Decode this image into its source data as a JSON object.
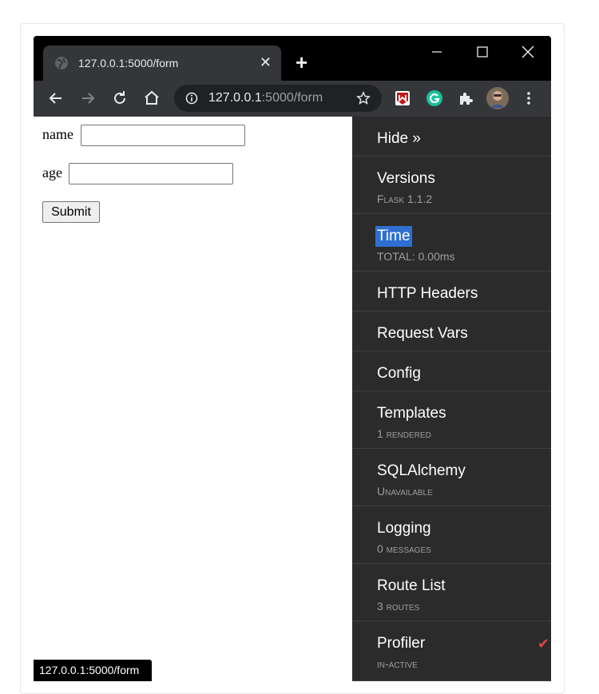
{
  "browser": {
    "tab_title": "127.0.0.1:5000/form",
    "url_host": "127.0.0.1",
    "url_rest": ":5000/form",
    "status_url": "127.0.0.1:5000/form",
    "tab_close": "✕",
    "new_tab": "+"
  },
  "form": {
    "name_label": "name",
    "name_value": "",
    "age_label": "age",
    "age_value": "",
    "submit_label": "Submit"
  },
  "debug_toolbar": {
    "hide_label": "Hide »",
    "items": [
      {
        "title": "Versions",
        "subtitle": "Flask 1.1.2"
      },
      {
        "title": "Time",
        "subtitle": "TOTAL: 0.00ms",
        "selected": true
      },
      {
        "title": "HTTP Headers",
        "subtitle": ""
      },
      {
        "title": "Request Vars",
        "subtitle": ""
      },
      {
        "title": "Config",
        "subtitle": ""
      },
      {
        "title": "Templates",
        "subtitle": "1 rendered"
      },
      {
        "title": "SQLAlchemy",
        "subtitle": "Unavailable"
      },
      {
        "title": "Logging",
        "subtitle": "0 messages"
      },
      {
        "title": "Route List",
        "subtitle": "3 routes"
      },
      {
        "title": "Profiler",
        "subtitle": "in-active",
        "checked": true
      }
    ],
    "check_glyph": "✔"
  },
  "colors": {
    "panel_bg": "#2b2b2b",
    "selected_highlight": "#2f6fd1",
    "check_color": "#e04545"
  }
}
